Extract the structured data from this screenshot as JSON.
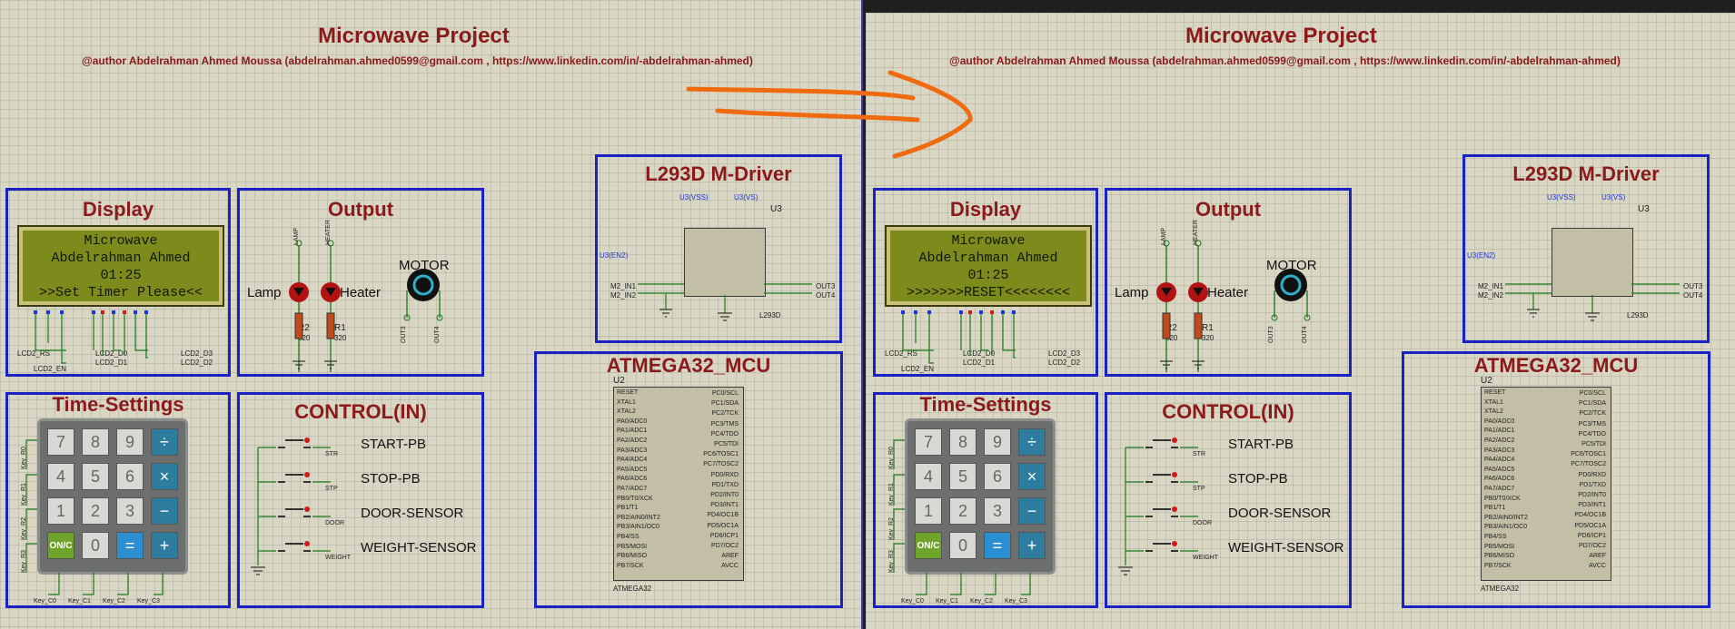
{
  "panes": [
    {
      "title": "Microwave Project",
      "author": "@author Abdelrahman Ahmed Moussa (abdelrahman.ahmed0599@gmail.com  , https://www.linkedin.com/in/-abdelrahman-ahmed)",
      "display": {
        "title": "Display",
        "line1": "Microwave",
        "line2": "Abdelrahman Ahmed",
        "line3": "01:25",
        "line4": ">>Set Timer Please<<"
      },
      "output": {
        "title": "Output",
        "lamp_ref": "LAMP",
        "heater_ref": "HEATER",
        "lamp": "Lamp",
        "heater": "Heater",
        "motor": "MOTOR",
        "r2": "R2",
        "r1": "R1",
        "r2_val": "320",
        "r1_val": "320",
        "out3": "OUT3",
        "out4": "OUT4"
      },
      "driver": {
        "title": "L293D M-Driver",
        "ref": "U3",
        "part": "L293D",
        "vss": "U3(VSS)",
        "vs": "U3(VS)",
        "en2": "U3(EN2)",
        "in1": "M2_IN1",
        "in2": "M2_IN2",
        "out3": "OUT3",
        "out4": "OUT4"
      },
      "mcu": {
        "title": "ATMEGA32_MCU",
        "ref": "U2",
        "part": "ATMEGA32",
        "left_pins": [
          "RESET",
          "XTAL1",
          "XTAL2",
          "PA0/ADC0",
          "PA1/ADC1",
          "PA2/ADC2",
          "PA3/ADC3",
          "PA4/ADC4",
          "PA5/ADC5",
          "PA6/ADC6",
          "PA7/ADC7",
          "PB0/T0/XCK",
          "PB1/T1",
          "PB2/AIN0/INT2",
          "PB3/AIN1/OC0",
          "PB4/SS",
          "PB5/MOSI",
          "PB6/MISO",
          "PB7/SCK"
        ],
        "right_pins": [
          "PC0/SCL",
          "PC1/SDA",
          "PC2/TCK",
          "PC3/TMS",
          "PC4/TDO",
          "PC5/TDI",
          "PC6/TOSC1",
          "PC7/TOSC2",
          "PD0/RXD",
          "PD1/TXD",
          "PD2/INT0",
          "PD3/INT1",
          "PD4/OC1B",
          "PD5/OC1A",
          "PD6/ICP1",
          "PD7/OC2",
          "AREF",
          "AVCC"
        ]
      },
      "time": {
        "title": "Time-Settings",
        "keys": [
          "7",
          "8",
          "9",
          "÷",
          "4",
          "5",
          "6",
          "×",
          "1",
          "2",
          "3",
          "−",
          "ON/C",
          "0",
          "=",
          "+"
        ],
        "rows": [
          "Key_R0",
          "Key_R1",
          "Key_R2",
          "Key_R3"
        ],
        "cols": [
          "Key_C0",
          "Key_C1",
          "Key_C2",
          "Key_C3"
        ]
      },
      "control": {
        "title": "CONTROL(IN)",
        "items": [
          "START-PB",
          "STOP-PB",
          "DOOR-SENSOR",
          "WEIGHT-SENSOR"
        ],
        "refs": [
          "STR",
          "STP",
          "DOOR",
          "WEIGHT"
        ]
      },
      "lcd_pins": {
        "rs": "LCD2_RS",
        "en": "LCD2_EN",
        "d0": "LCD2_D0",
        "d1": "LCD2_D1",
        "d2": "LCD2_D2",
        "d3": "LCD2_D3"
      }
    },
    {
      "title": "Microwave Project",
      "author": "@author Abdelrahman Ahmed Moussa (abdelrahman.ahmed0599@gmail.com  , https://www.linkedin.com/in/-abdelrahman-ahmed)",
      "display": {
        "title": "Display",
        "line1": "Microwave",
        "line2": "Abdelrahman Ahmed",
        "line3": "01:25",
        "line4": ">>>>>>>RESET<<<<<<<<"
      },
      "output": {
        "title": "Output",
        "lamp_ref": "LAMP",
        "heater_ref": "HEATER",
        "lamp": "Lamp",
        "heater": "Heater",
        "motor": "MOTOR",
        "r2": "R2",
        "r1": "R1",
        "r2_val": "320",
        "r1_val": "320",
        "out3": "OUT3",
        "out4": "OUT4"
      },
      "driver": {
        "title": "L293D M-Driver",
        "ref": "U3",
        "part": "L293D",
        "vss": "U3(VSS)",
        "vs": "U3(VS)",
        "en2": "U3(EN2)",
        "in1": "M2_IN1",
        "in2": "M2_IN2",
        "out3": "OUT3",
        "out4": "OUT4"
      },
      "mcu": {
        "title": "ATMEGA32_MCU",
        "ref": "U2",
        "part": "ATMEGA32",
        "left_pins": [
          "RESET",
          "XTAL1",
          "XTAL2",
          "PA0/ADC0",
          "PA1/ADC1",
          "PA2/ADC2",
          "PA3/ADC3",
          "PA4/ADC4",
          "PA5/ADC5",
          "PA6/ADC6",
          "PA7/ADC7",
          "PB0/T0/XCK",
          "PB1/T1",
          "PB2/AIN0/INT2",
          "PB3/AIN1/OC0",
          "PB4/SS",
          "PB5/MOSI",
          "PB6/MISO",
          "PB7/SCK"
        ],
        "right_pins": [
          "PC0/SCL",
          "PC1/SDA",
          "PC2/TCK",
          "PC3/TMS",
          "PC4/TDO",
          "PC5/TDI",
          "PC6/TOSC1",
          "PC7/TOSC2",
          "PD0/RXD",
          "PD1/TXD",
          "PD2/INT0",
          "PD3/INT1",
          "PD4/OC1B",
          "PD5/OC1A",
          "PD6/ICP1",
          "PD7/OC2",
          "AREF",
          "AVCC"
        ]
      },
      "time": {
        "title": "Time-Settings",
        "keys": [
          "7",
          "8",
          "9",
          "÷",
          "4",
          "5",
          "6",
          "×",
          "1",
          "2",
          "3",
          "−",
          "ON/C",
          "0",
          "=",
          "+"
        ],
        "rows": [
          "Key_R0",
          "Key_R1",
          "Key_R2",
          "Key_R3"
        ],
        "cols": [
          "Key_C0",
          "Key_C1",
          "Key_C2",
          "Key_C3"
        ]
      },
      "control": {
        "title": "CONTROL(IN)",
        "items": [
          "START-PB",
          "STOP-PB",
          "DOOR-SENSOR",
          "WEIGHT-SENSOR"
        ],
        "refs": [
          "STR",
          "STP",
          "DOOR",
          "WEIGHT"
        ]
      },
      "lcd_pins": {
        "rs": "LCD2_RS",
        "en": "LCD2_EN",
        "d0": "LCD2_D0",
        "d1": "LCD2_D1",
        "d2": "LCD2_D2",
        "d3": "LCD2_D3"
      }
    }
  ],
  "colors": {
    "title": "#8b1a1a",
    "box_border": "#1a22c4",
    "annotation": "#f06a10",
    "wire": "#1a7a1a"
  }
}
